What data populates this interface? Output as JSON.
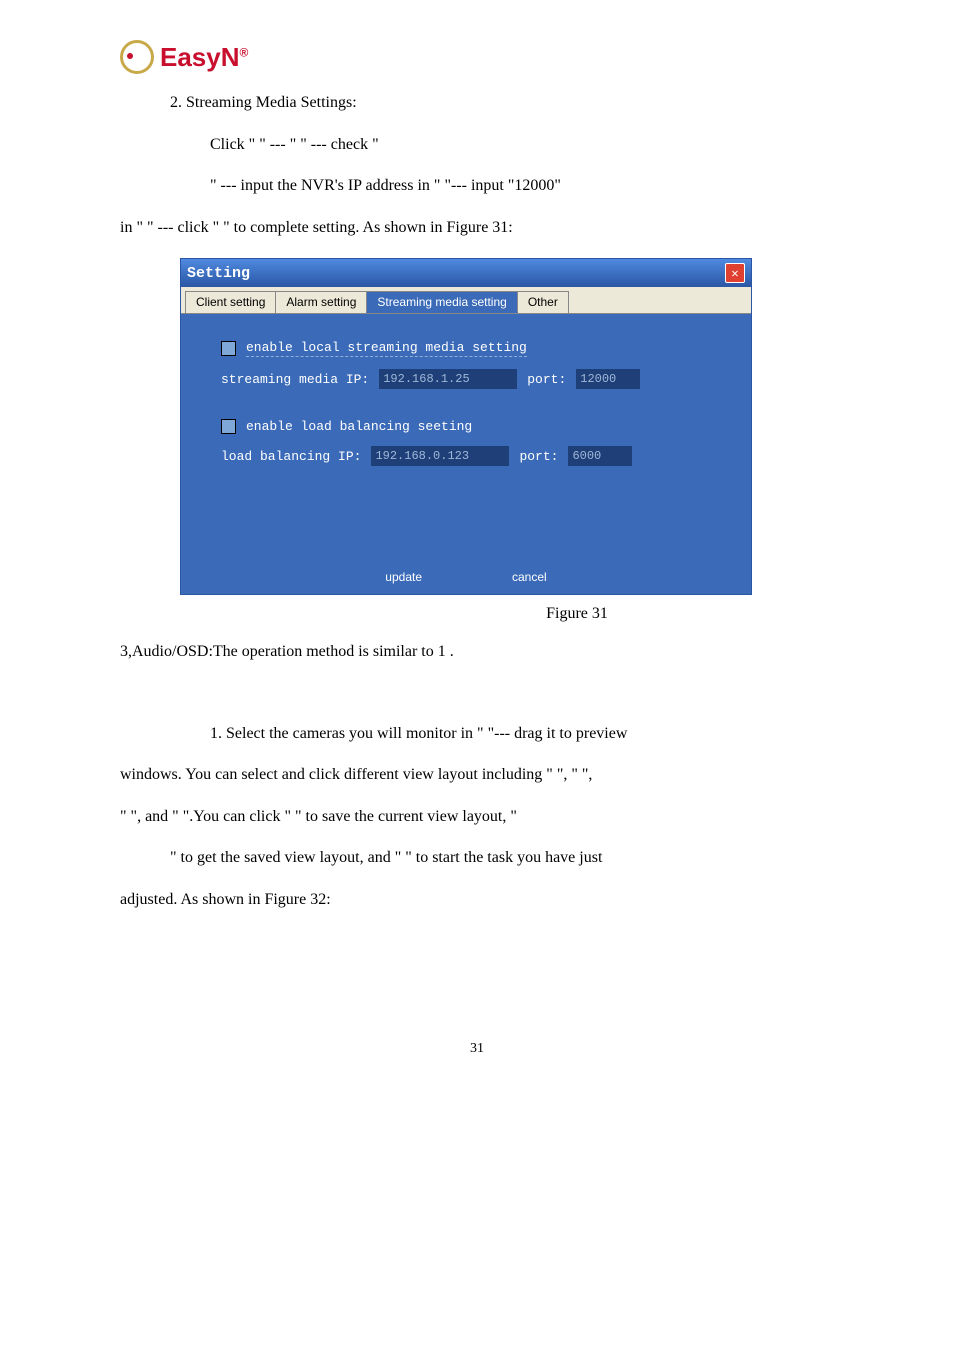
{
  "logo": {
    "brand": "EasyN",
    "reg": "®"
  },
  "para": {
    "p2_heading": "2. Streaming Media Settings:",
    "p2_l1": "Click \"         \" --- \"                                   \" --- check \"",
    "p2_l2": "\" --- input the NVR's IP address in \"                          \"--- input \"12000\"",
    "p2_l3": "in \"      \" --- click \"           \" to complete setting.   As shown in Figure 31:",
    "fig31": "Figure 31",
    "p3_line": "3,Audio/OSD:The operation method is similar to 1 .",
    "mon_l1": "1. Select the cameras you will monitor in \"                       \"--- drag it to preview",
    "mon_l2": "windows. You can select and click different view layout including \"               \", \"           \",",
    "mon_l3": "\"           \", and \"           \".You can click \"             \" to save the current view layout, \"",
    "mon_l4": "\" to get the saved view layout, and \"             \" to start the task you have just",
    "mon_l5": "adjusted. As shown in Figure 32:"
  },
  "dialog": {
    "title": "Setting",
    "tabs": {
      "t1": "Client setting",
      "t2": "Alarm setting",
      "t3": "Streaming media setting",
      "t4": "Other"
    },
    "enable_stream_label": "enable local streaming media setting",
    "stream_ip_label": "streaming media IP:",
    "stream_ip_value": "192.168.1.25",
    "port_label": "port:",
    "stream_port_value": "12000",
    "enable_lb_label": "enable load balancing seeting",
    "lb_ip_label": "load balancing IP:",
    "lb_ip_value": "192.168.0.123",
    "lb_port_value": "6000",
    "btn_update": "update",
    "btn_cancel": "cancel"
  },
  "page_number": "31"
}
